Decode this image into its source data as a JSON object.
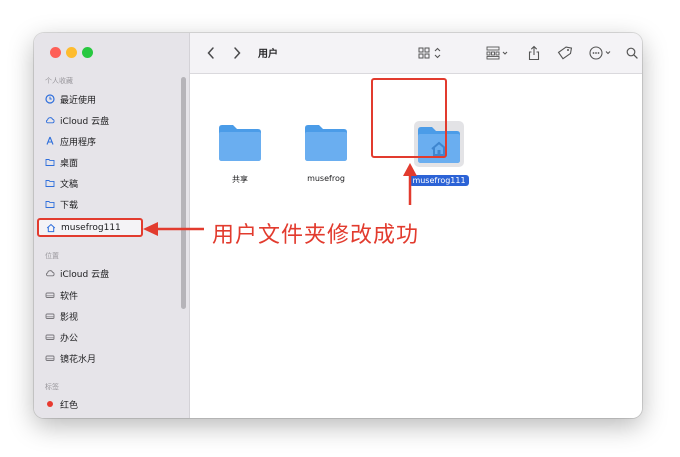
{
  "sidebar": {
    "favorites_label": "个人收藏",
    "favorites": [
      {
        "label": "最近使用",
        "icon": "clock-icon"
      },
      {
        "label": "iCloud 云盘",
        "icon": "cloud-icon"
      },
      {
        "label": "应用程序",
        "icon": "apps-icon"
      },
      {
        "label": "桌面",
        "icon": "folder-icon"
      },
      {
        "label": "文稿",
        "icon": "folder-icon"
      },
      {
        "label": "下载",
        "icon": "folder-icon"
      },
      {
        "label": "musefrog111",
        "icon": "home-icon"
      }
    ],
    "locations_label": "位置",
    "locations": [
      {
        "label": "iCloud 云盘",
        "icon": "cloud-icon"
      },
      {
        "label": "软件",
        "icon": "drive-icon"
      },
      {
        "label": "影视",
        "icon": "drive-icon"
      },
      {
        "label": "办公",
        "icon": "drive-icon"
      },
      {
        "label": "镜花水月",
        "icon": "drive-icon"
      }
    ],
    "tags_label": "标签",
    "tags": [
      {
        "label": "红色",
        "color": "#e8392f"
      }
    ]
  },
  "toolbar": {
    "title": "用户"
  },
  "files": [
    {
      "name": "共享",
      "icon": "folder-icon"
    },
    {
      "name": "musefrog",
      "icon": "folder-icon"
    },
    {
      "name": "musefrog111",
      "icon": "home-folder-icon",
      "selected": true
    }
  ],
  "annotation": {
    "text": "用户文件夹修改成功",
    "color": "#e23b2e"
  },
  "colors": {
    "accent": "#2c63d6",
    "folder": "#6aaef0",
    "annotation": "#e23b2e"
  }
}
